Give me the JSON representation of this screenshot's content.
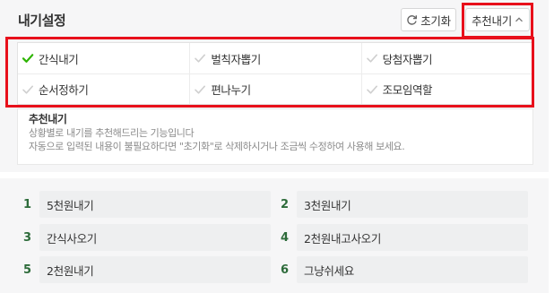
{
  "panel": {
    "title": "내기설정",
    "reset_label": "초기화",
    "reset_icon": "refresh-icon",
    "recommend_label": "추천내기",
    "recommend_icon": "chevron-up-icon"
  },
  "colors": {
    "check_active": "#2db400",
    "check_inactive": "#cfcfcf",
    "highlight": "#e8101b",
    "number": "#2d6b3a"
  },
  "options": [
    {
      "label": "간식내기",
      "checked": true
    },
    {
      "label": "벌칙자뽑기",
      "checked": false
    },
    {
      "label": "당첨자뽑기",
      "checked": false
    },
    {
      "label": "순서정하기",
      "checked": false
    },
    {
      "label": "편나누기",
      "checked": false
    },
    {
      "label": "조모임역할",
      "checked": false
    }
  ],
  "description": {
    "title": "추천내기",
    "line1": "상황별로 내기를 추천해드리는 기능입니다",
    "line2": "자동으로 입력된 내용이 불필요하다면 \"초기화\"로 삭제하시거나 조금씩 수정하여 사용해 보세요."
  },
  "entries": [
    {
      "num": "1",
      "text": "5천원내기"
    },
    {
      "num": "2",
      "text": "3천원내기"
    },
    {
      "num": "3",
      "text": "간식사오기"
    },
    {
      "num": "4",
      "text": "2천원내고사오기"
    },
    {
      "num": "5",
      "text": "2천원내기"
    },
    {
      "num": "6",
      "text": "그냥쉬세요"
    }
  ]
}
